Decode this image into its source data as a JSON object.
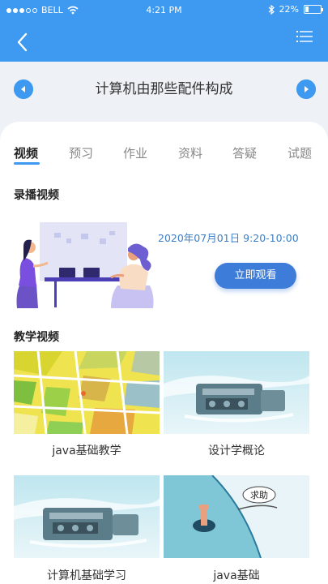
{
  "status_bar": {
    "carrier": "BELL",
    "time": "4:21 PM",
    "battery_percent": "22%",
    "battery_level": 0.22
  },
  "nav": {
    "back_icon": "chevron-left-icon",
    "menu_icon": "list-menu-icon"
  },
  "course": {
    "title": "计算机由那些配件构成"
  },
  "tabs": [
    {
      "label": "视频",
      "active": true
    },
    {
      "label": "预习",
      "active": false
    },
    {
      "label": "作业",
      "active": false
    },
    {
      "label": "资料",
      "active": false
    },
    {
      "label": "答疑",
      "active": false
    },
    {
      "label": "试题",
      "active": false
    }
  ],
  "recorded": {
    "section_title": "录播视频",
    "date_time": "2020年07月01日  9:20-10:00",
    "watch_button": "立即观看"
  },
  "teaching": {
    "section_title": "教学视频",
    "videos": [
      {
        "title": "java基础教学"
      },
      {
        "title": "设计学概论"
      },
      {
        "title": "计算机基础学习"
      },
      {
        "title": "java基础"
      }
    ]
  },
  "illustration_text": "求助",
  "colors": {
    "primary": "#3d9af0",
    "button": "#3d7cd8",
    "date_text": "#3d7ec6"
  }
}
